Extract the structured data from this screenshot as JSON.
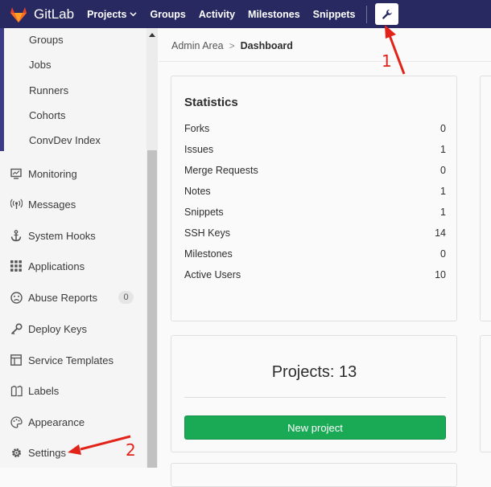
{
  "navbar": {
    "brand": "GitLab",
    "items": [
      "Projects",
      "Groups",
      "Activity",
      "Milestones",
      "Snippets"
    ],
    "admin_icon": "wrench-icon"
  },
  "sidebar": {
    "sub_items": [
      "Groups",
      "Jobs",
      "Runners",
      "Cohorts",
      "ConvDev Index"
    ],
    "items": [
      {
        "label": "Monitoring",
        "icon": "monitor-icon"
      },
      {
        "label": "Messages",
        "icon": "broadcast-icon"
      },
      {
        "label": "System Hooks",
        "icon": "anchor-icon"
      },
      {
        "label": "Applications",
        "icon": "grid-icon"
      },
      {
        "label": "Abuse Reports",
        "icon": "frown-icon",
        "badge": "0"
      },
      {
        "label": "Deploy Keys",
        "icon": "key-icon"
      },
      {
        "label": "Service Templates",
        "icon": "template-icon"
      },
      {
        "label": "Labels",
        "icon": "labels-icon"
      },
      {
        "label": "Appearance",
        "icon": "palette-icon"
      },
      {
        "label": "Settings",
        "icon": "gear-icon"
      }
    ]
  },
  "breadcrumb": {
    "root": "Admin Area",
    "separator": ">",
    "current": "Dashboard"
  },
  "statistics": {
    "title": "Statistics",
    "rows": [
      {
        "label": "Forks",
        "value": "0"
      },
      {
        "label": "Issues",
        "value": "1"
      },
      {
        "label": "Merge Requests",
        "value": "0"
      },
      {
        "label": "Notes",
        "value": "1"
      },
      {
        "label": "Snippets",
        "value": "1"
      },
      {
        "label": "SSH Keys",
        "value": "14"
      },
      {
        "label": "Milestones",
        "value": "0"
      },
      {
        "label": "Active Users",
        "value": "10"
      }
    ]
  },
  "projects": {
    "title": "Projects: 13",
    "button": "New project"
  },
  "annotations": {
    "one": "1",
    "two": "2"
  },
  "colors": {
    "navbar": "#292961",
    "primary_button": "#1aaa55",
    "annotation": "#e2231a"
  }
}
